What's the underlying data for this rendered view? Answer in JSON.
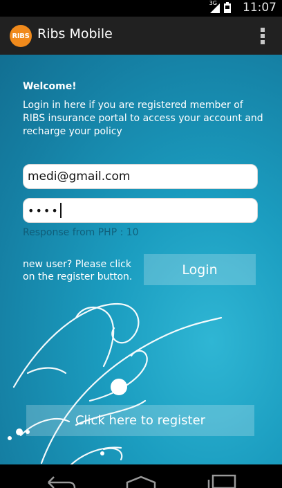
{
  "status_bar": {
    "network_label": "3G",
    "time": "11:07"
  },
  "action_bar": {
    "logo_text": "RIBS",
    "title": "Ribs Mobile",
    "overflow_icon": "overflow-menu-icon"
  },
  "main": {
    "welcome": "Welcome!",
    "intro": "Login in here if you are registered member of RIBS insurance portal to access your account and recharge your policy",
    "email_value": "medi@gmail.com",
    "password_masked": "••••",
    "response_text": "Response from PHP : 10",
    "new_user_text": "new user? Please click on the register button.",
    "login_label": "Login",
    "register_label": "Click here to register"
  },
  "nav_bar": {
    "icons": [
      "back-icon",
      "home-icon",
      "recents-icon"
    ]
  },
  "colors": {
    "accent": "#f08a1c",
    "action_bar": "#212121",
    "background": "#1b9dc0"
  }
}
